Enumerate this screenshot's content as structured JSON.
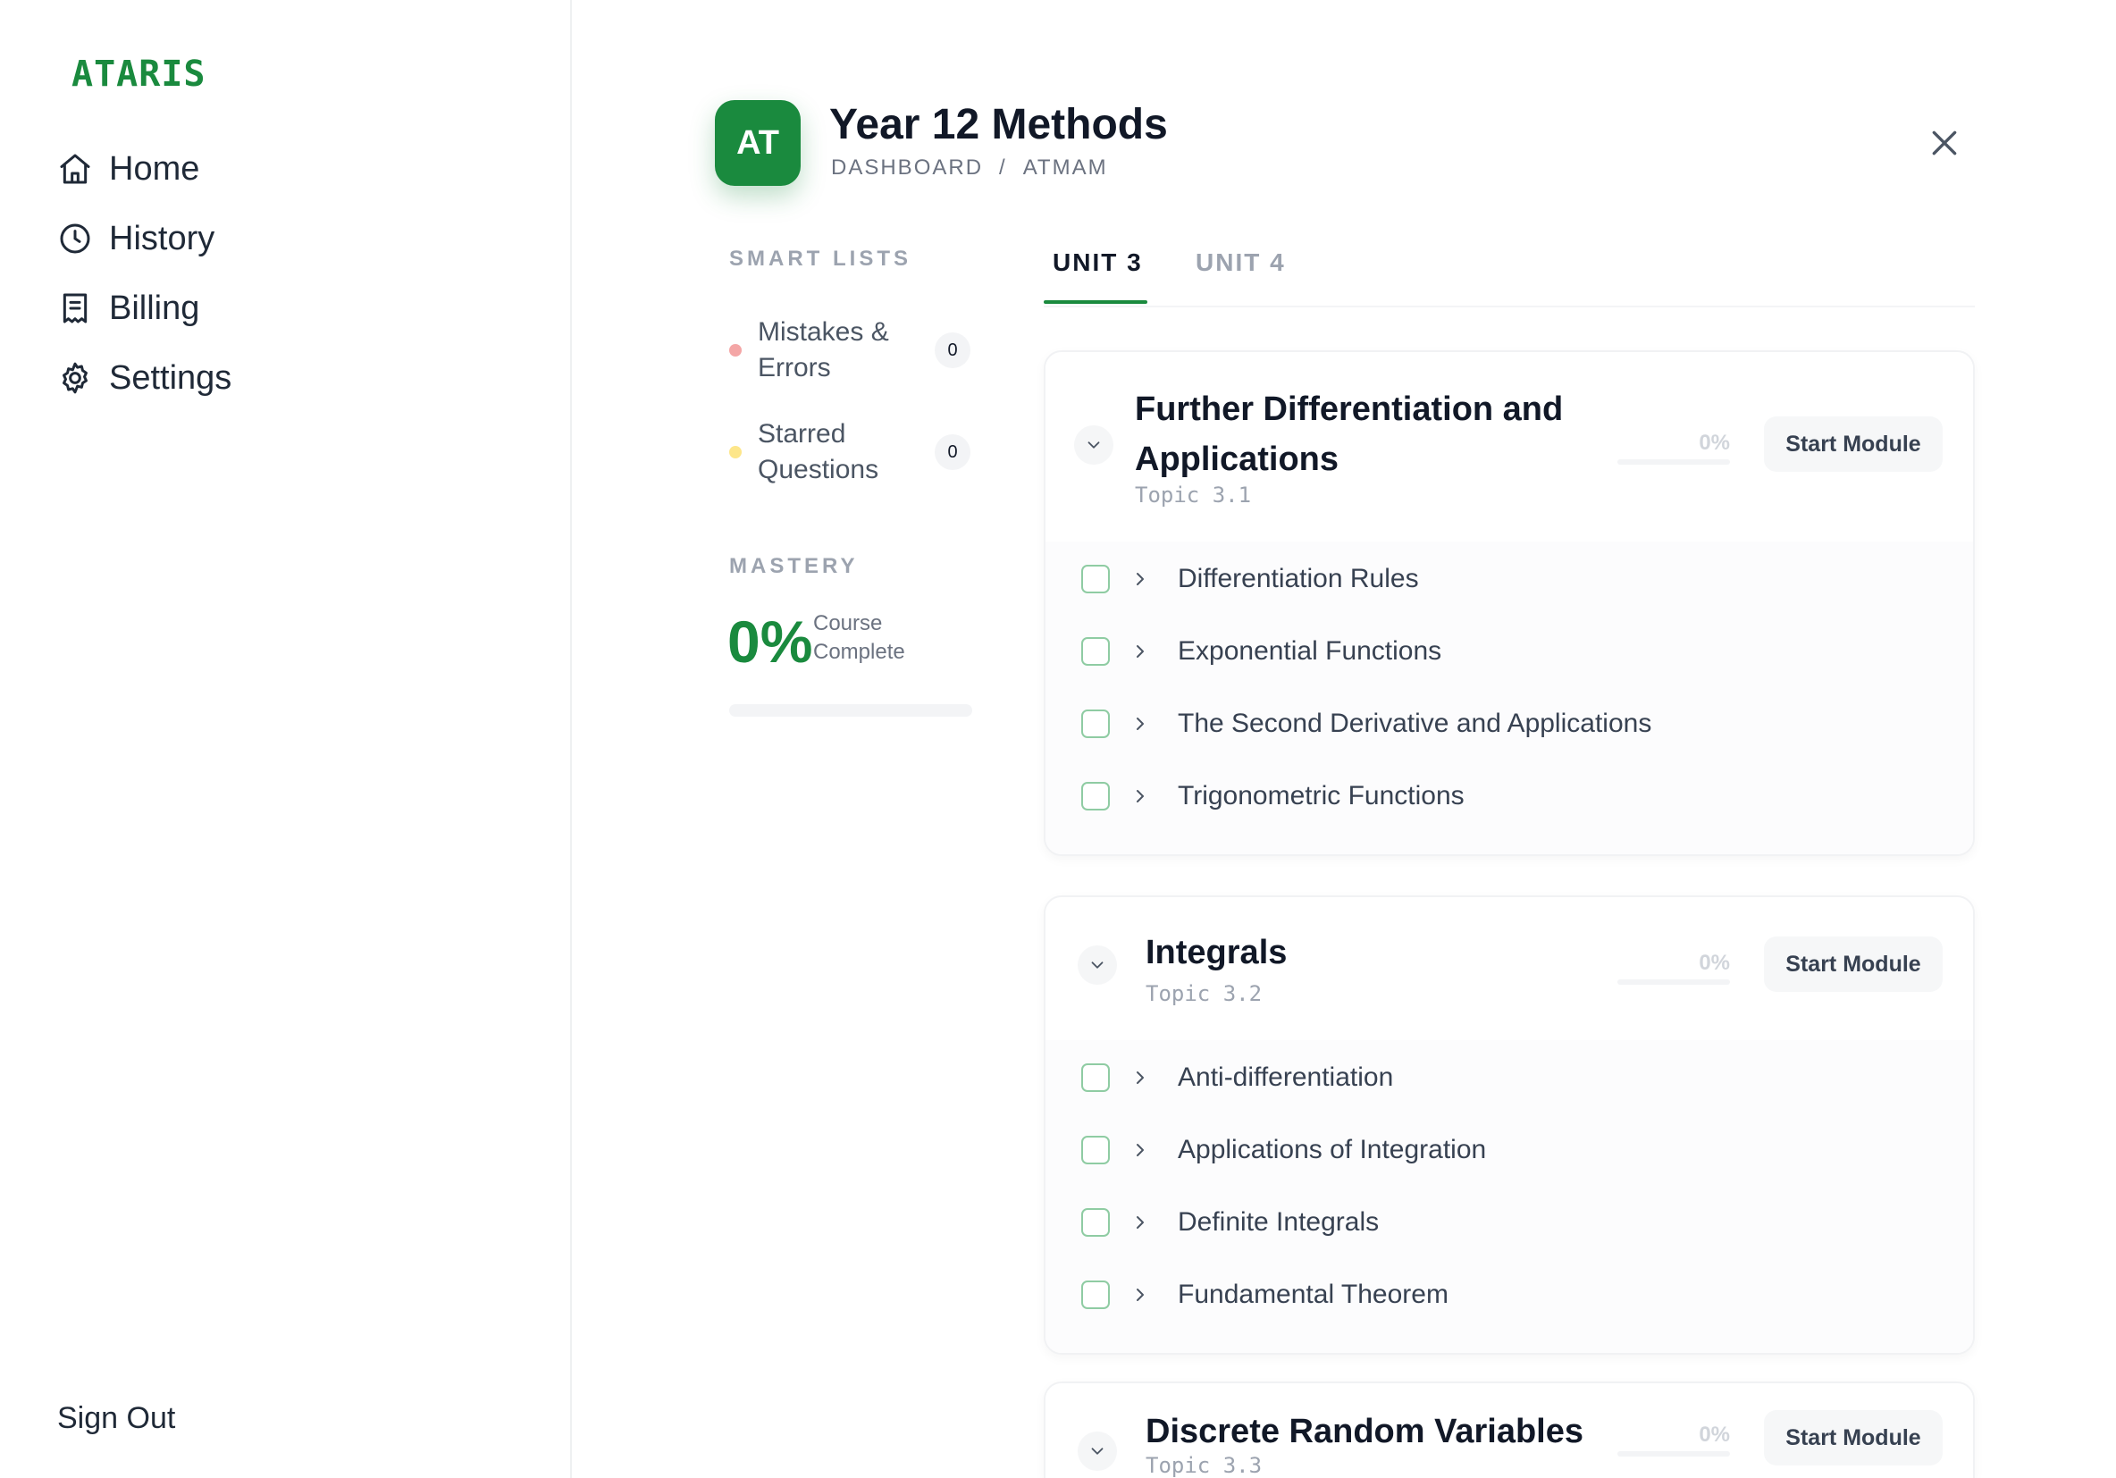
{
  "app": {
    "logo": "ATARIS"
  },
  "sidebar": {
    "items": [
      {
        "label": "Home",
        "icon": "home-icon"
      },
      {
        "label": "History",
        "icon": "clock-icon"
      },
      {
        "label": "Billing",
        "icon": "receipt-icon"
      },
      {
        "label": "Settings",
        "icon": "gear-icon"
      }
    ],
    "sign_out": "Sign Out"
  },
  "header": {
    "avatar_initials": "AT",
    "title": "Year 12 Methods",
    "breadcrumb": [
      "DASHBOARD",
      "/",
      "ATMAM"
    ]
  },
  "smart_lists": {
    "label": "SMART LISTS",
    "items": [
      {
        "label": "Mistakes & Errors",
        "count": "0",
        "dot_color": "#f4a6a6"
      },
      {
        "label": "Starred Questions",
        "count": "0",
        "dot_color": "#fde68a"
      }
    ]
  },
  "mastery": {
    "label": "MASTERY",
    "value": "0%",
    "caption": "Course Complete",
    "progress": 0
  },
  "tabs": [
    {
      "label": "UNIT 3",
      "active": true
    },
    {
      "label": "UNIT 4",
      "active": false
    }
  ],
  "modules": [
    {
      "title": "Further Differentiation and Applications",
      "topic": "Topic 3.1",
      "percent": "0%",
      "button": "Start Module",
      "lessons": [
        "Differentiation Rules",
        "Exponential Functions",
        "The Second Derivative and Applications",
        "Trigonometric Functions"
      ]
    },
    {
      "title": "Integrals",
      "topic": "Topic 3.2",
      "percent": "0%",
      "button": "Start Module",
      "lessons": [
        "Anti-differentiation",
        "Applications of Integration",
        "Definite Integrals",
        "Fundamental Theorem"
      ]
    },
    {
      "title": "Discrete Random Variables",
      "topic": "Topic 3.3",
      "percent": "0%",
      "button": "Start Module",
      "lessons": []
    }
  ],
  "colors": {
    "accent": "#1a8a3e",
    "text": "#111827",
    "muted": "#9ca3af"
  }
}
